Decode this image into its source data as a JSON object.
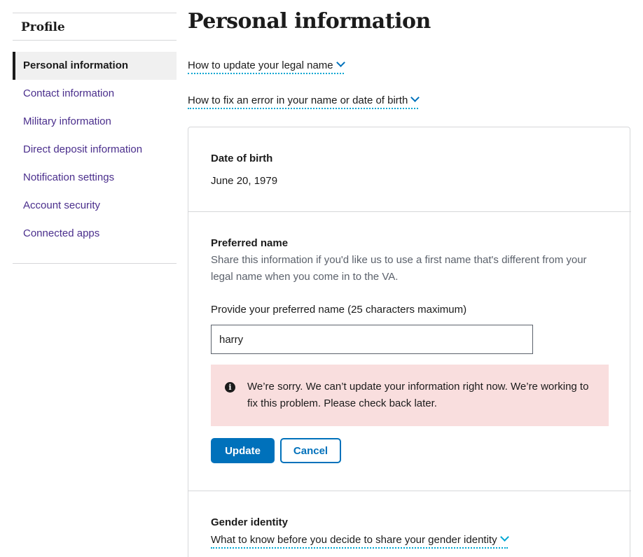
{
  "sidebar": {
    "title": "Profile",
    "items": [
      {
        "label": "Personal information",
        "active": true
      },
      {
        "label": "Contact information"
      },
      {
        "label": "Military information"
      },
      {
        "label": "Direct deposit information"
      },
      {
        "label": "Notification settings"
      },
      {
        "label": "Account security"
      },
      {
        "label": "Connected apps"
      }
    ]
  },
  "main": {
    "title": "Personal information",
    "accordions": [
      {
        "label": "How to update your legal name"
      },
      {
        "label": "How to fix an error in your name or date of birth"
      }
    ],
    "date_of_birth": {
      "label": "Date of birth",
      "value": "June 20, 1979"
    },
    "preferred_name": {
      "label": "Preferred name",
      "hint": "Share this information if you'd like us to use a first name that's different from your legal name when you come in to the VA.",
      "field_label": "Provide your preferred name (25 characters maximum)",
      "input_value": "harry",
      "error_message": "We’re sorry. We can’t update your information right now. We’re working to fix this problem. Please check back later.",
      "update_label": "Update",
      "cancel_label": "Cancel"
    },
    "gender_identity": {
      "label": "Gender identity",
      "accordion_label": "What to know before you decide to share your gender identity"
    }
  },
  "colors": {
    "link": "#4a2e8c",
    "primary": "#0071bb",
    "accent": "#00a6d2",
    "error_bg": "#f9dede"
  },
  "icons": {
    "accordion": "chevron-down-icon",
    "alert": "info-icon"
  }
}
